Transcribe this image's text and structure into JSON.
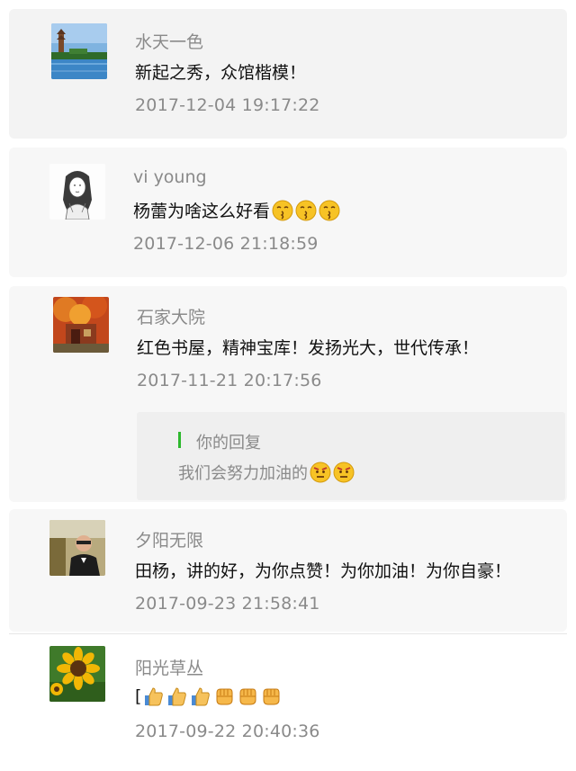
{
  "comments": [
    {
      "name": "水天一色",
      "text": "新起之秀，众馆楷模！",
      "time": "2017-12-04 19:17:22",
      "avatar_icon": "lake-pagoda-photo-icon",
      "emojis": []
    },
    {
      "name": "vi young",
      "text": "杨蕾为啥这么好看",
      "time": "2017-12-06 21:18:59",
      "avatar_icon": "sketch-portrait-icon",
      "emojis": [
        "kiss-face-emoji",
        "kiss-face-emoji",
        "kiss-face-emoji"
      ]
    },
    {
      "name": "石家大院",
      "text": "红色书屋，精神宝库！发扬光大，世代传承！",
      "time": "2017-11-21 20:17:56",
      "avatar_icon": "autumn-courtyard-photo-icon",
      "emojis": [],
      "reply": {
        "label": "你的回复",
        "text": "我们会努力加油的",
        "emojis": [
          "determined-face-emoji",
          "determined-face-emoji"
        ]
      }
    },
    {
      "name": "夕阳无限",
      "text": "田杨，讲的好，为你点赞！为你加油！为你自豪！",
      "time": "2017-09-23 21:58:41",
      "avatar_icon": "man-portrait-photo-icon",
      "emojis": []
    },
    {
      "name": "阳光草丛",
      "text": "[",
      "time": "2017-09-22 20:40:36",
      "avatar_icon": "sunflower-photo-icon",
      "emojis": [
        "thumbs-up-emoji",
        "thumbs-up-emoji",
        "thumbs-up-emoji",
        "fist-emoji",
        "fist-emoji",
        "fist-emoji"
      ]
    }
  ],
  "colors": {
    "card_background": "#f7f7f7",
    "reply_background": "#efefef",
    "reply_bar": "#2eb82e",
    "meta_text": "#8a8a8a",
    "body_text": "#111111"
  }
}
